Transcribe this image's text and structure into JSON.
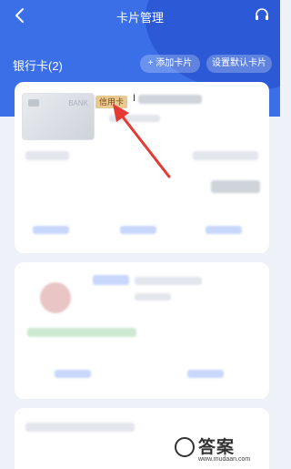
{
  "header": {
    "title": "卡片管理",
    "back_icon": "chevron-left-icon",
    "support_icon": "headset-icon"
  },
  "section": {
    "title": "银行卡(2)",
    "add_label": "+ 添加卡片",
    "default_label": "设置默认卡片"
  },
  "card1": {
    "bank_text": "BANK",
    "badge": "信用卡",
    "name_mark": "I"
  },
  "watermark": {
    "logo": "答案",
    "url": "www.mudaan.com"
  },
  "colors": {
    "accent": "#3a6fe8",
    "badge_bg": "#e8c993",
    "arrow": "#e53935"
  }
}
